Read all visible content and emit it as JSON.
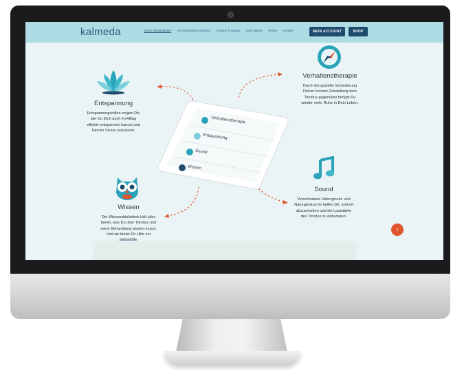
{
  "header": {
    "logo": "kalmeda",
    "nav": [
      "Deine Wegbegleiter",
      "So funktioniert Kalmeda",
      "Tinnitus Therapie",
      "Jetzt starten",
      "Preise",
      "Kontakt"
    ],
    "account_label": "MEIN ACCOUNT",
    "shop_label": "SHOP"
  },
  "features": {
    "verhaltenstherapie": {
      "title": "Verhaltenstherapie",
      "lines": [
        "Durch die gezielte Veränderung",
        "Deiner inneren Einstellung dem",
        "Tinnitus gegenüber bringst Du",
        "wieder mehr Ruhe in Dein Leben."
      ]
    },
    "entspannung": {
      "title": "Entspannung",
      "lines": [
        "Entspannungshilfen zeigen Dir,",
        "wie Du Dich auch im Alltag",
        "effektiv entspannen kannst und",
        "Deinen Stress reduzierst."
      ]
    },
    "sound": {
      "title": "Sound",
      "lines": [
        "Verschiedene Hintergrund- und",
        "Naturgeräusche helfen Dir, schnell",
        "abzuschalten und die Lautstärke",
        "des Tinnitus zu reduzieren."
      ]
    },
    "wissen": {
      "title": "Wissen",
      "lines": [
        "Die Wissensbibliothek hält alles",
        "bereit, was Du über Tinnitus und",
        "seine Behandlung wissen musst.",
        "Und sie bietet Dir Hilfe zur",
        "Selbsthilfe."
      ]
    }
  },
  "phone_menu": [
    "Verhaltenstherapie",
    "Entspannung",
    "Sound",
    "Wissen"
  ],
  "colors": {
    "nav_bg": "#aedbe4",
    "page_bg": "#eaf4f6",
    "button_bg": "#1f4b6d",
    "accent_orange": "#e1552e",
    "icon_teal": "#2aa3b8"
  }
}
